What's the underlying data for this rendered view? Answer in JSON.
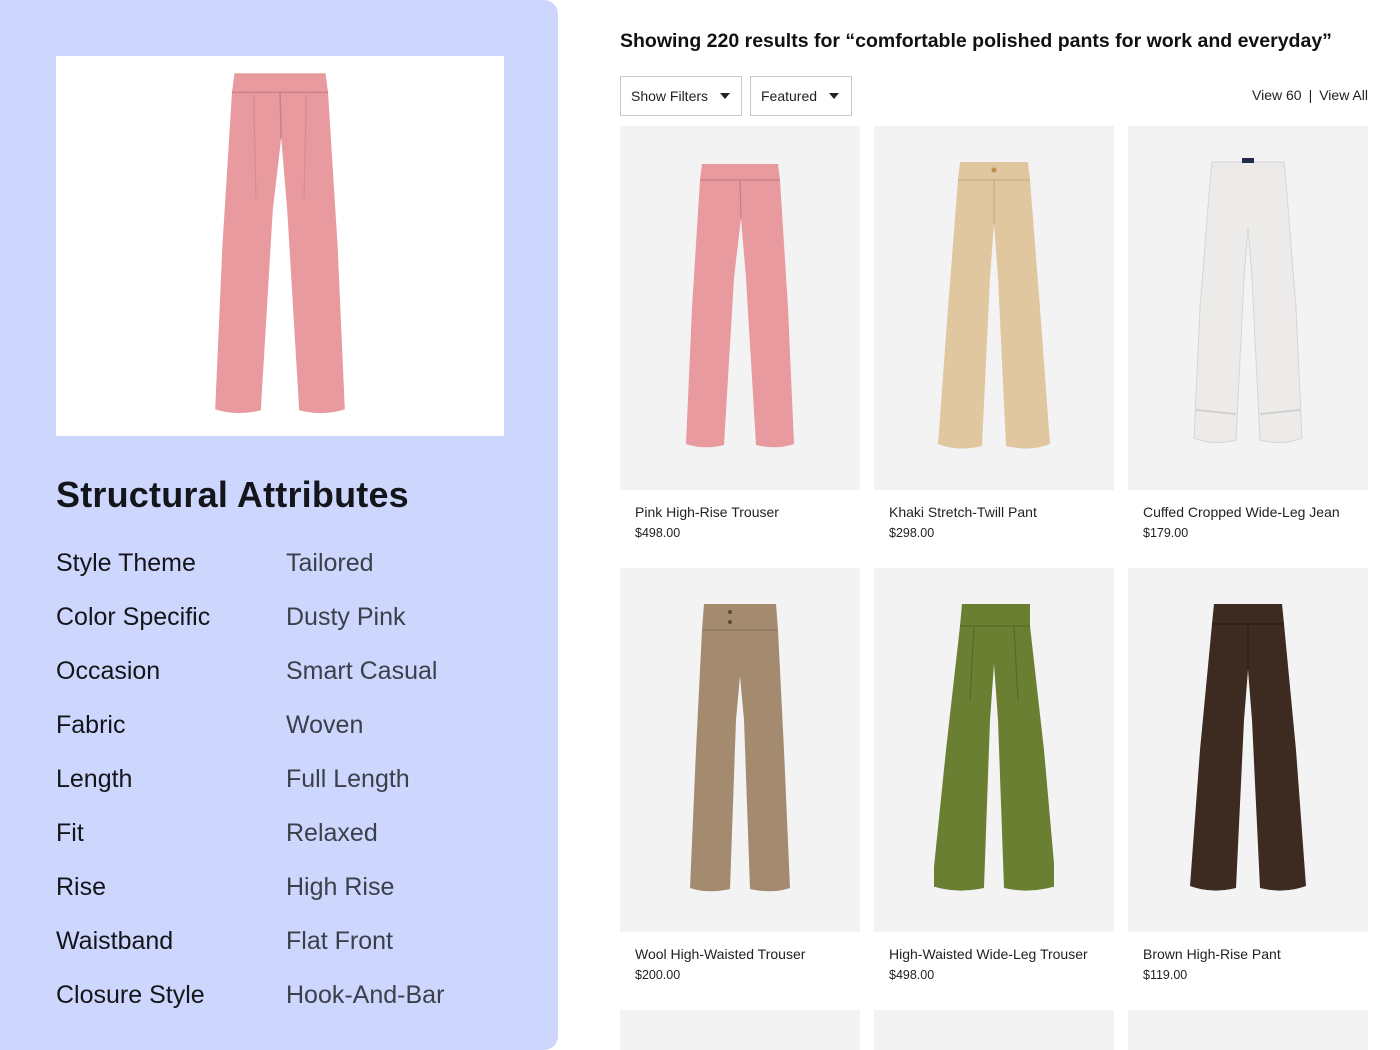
{
  "panel": {
    "hero_name": "Pink High-Rise Trouser",
    "title": "Structural Attributes",
    "attributes": [
      {
        "key": "Style Theme",
        "value": "Tailored"
      },
      {
        "key": "Color Specific",
        "value": "Dusty Pink"
      },
      {
        "key": "Occasion",
        "value": "Smart Casual"
      },
      {
        "key": "Fabric",
        "value": "Woven"
      },
      {
        "key": "Length",
        "value": "Full Length"
      },
      {
        "key": "Fit",
        "value": "Relaxed"
      },
      {
        "key": "Rise",
        "value": "High Rise"
      },
      {
        "key": "Waistband",
        "value": "Flat Front"
      },
      {
        "key": "Closure Style",
        "value": "Hook-And-Bar"
      }
    ]
  },
  "results": {
    "title": "Showing 220 results for “comfortable polished pants for work and everyday”",
    "filters_label": "Show Filters",
    "sort_label": "Featured",
    "view_60": "View 60",
    "separator": "|",
    "view_all": "View All"
  },
  "products": [
    {
      "name": "Pink High-Rise Trouser",
      "price": "$498.00",
      "color": "#e99a9f"
    },
    {
      "name": "Khaki Stretch-Twill Pant",
      "price": "$298.00",
      "color": "#e0c7a0"
    },
    {
      "name": "Cuffed Cropped Wide-Leg Jean",
      "price": "$179.00",
      "color": "#ecebea"
    },
    {
      "name": "Wool High-Waisted Trouser",
      "price": "$200.00",
      "color": "#a48b70"
    },
    {
      "name": "High-Waisted Wide-Leg Trouser",
      "price": "$498.00",
      "color": "#6b7f33"
    },
    {
      "name": "Brown High-Rise Pant",
      "price": "$119.00",
      "color": "#3d2b22"
    }
  ],
  "colors": {
    "panel_bg": "#cdd7fd",
    "card_bg": "#f4f3f4"
  }
}
